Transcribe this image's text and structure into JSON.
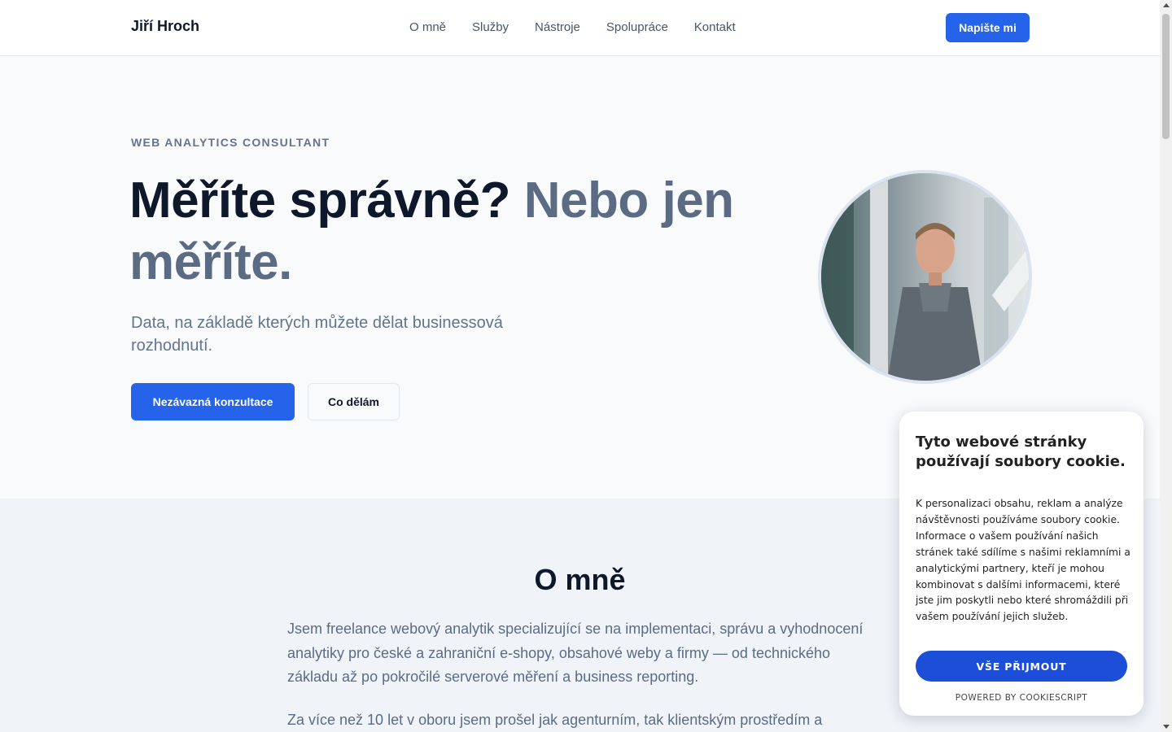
{
  "header": {
    "logo": "Jiří Hroch",
    "nav": [
      "O mně",
      "Služby",
      "Nástroje",
      "Spolupráce",
      "Kontakt"
    ],
    "cta": "Napište mi"
  },
  "hero": {
    "eyebrow": "WEB ANALYTICS CONSULTANT",
    "headline_main": "Měříte správně?",
    "headline_muted": "Nebo jen měříte.",
    "subtitle": "Data, na základě kterých můžete dělat businessová rozhodnutí.",
    "primary_button": "Nezávazná konzultace",
    "secondary_button": "Co dělám"
  },
  "about": {
    "title": "O mně",
    "paragraph1": "Jsem freelance webový analytik specializující se na implementaci, správu a vyhodnocení analytiky pro české a zahraniční e-shopy, obsahové weby a firmy — od technického základu až po pokročilé serverové měření a business reporting.",
    "paragraph2": "Za více než 10 let v oboru jsem prošel jak agenturním, tak klientským prostředím a"
  },
  "cookie": {
    "title": "Tyto webové stránky používají soubory cookie.",
    "text": "K personalizaci obsahu, reklam a analýze návštěvnosti používáme soubory cookie. Informace o vašem používání našich stránek také sdílíme s našimi reklamními a analytickými partnery, kteří je mohou kombinovat s dalšími informacemi, které jste jim poskytli nebo které shromáždili při vašem používání jejich služeb.",
    "accept_button": "VŠE PŘIJMOUT",
    "powered_by": "POWERED BY COOKIESCRIPT"
  },
  "colors": {
    "accent": "#2563eb",
    "cookie_button": "#1d4ed8",
    "muted_text": "#5b6b84"
  }
}
